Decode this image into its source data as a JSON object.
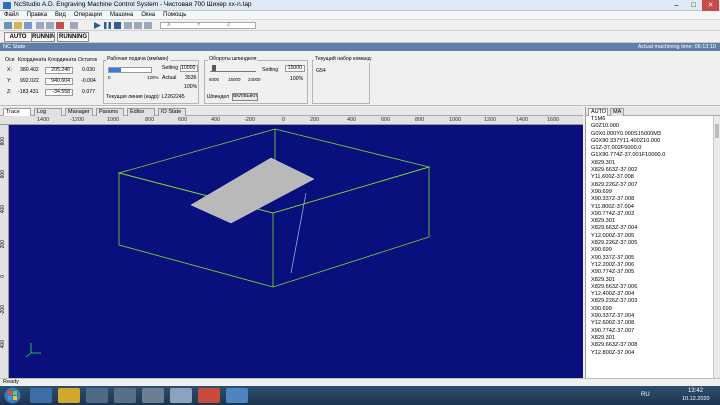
{
  "window": {
    "title": "NcStudio A.D. Engraving Machine Control System - Чистовая 700 Шихер xx-n.tap"
  },
  "menu": [
    "Файл",
    "Правка",
    "Вид",
    "Операции",
    "Машина",
    "Окна",
    "Помощь"
  ],
  "toolbar": {
    "x_label": "X",
    "y_label": "Y",
    "z_label": "Z"
  },
  "modes": [
    "AUTO",
    "RUNNING",
    "RUNNING"
  ],
  "state_header": {
    "title": "NC State",
    "actual_time": "Actual machining time: 06:13:10"
  },
  "coords": {
    "headers": [
      "Оси",
      "Координата",
      "Координата",
      "Остаток"
    ],
    "rows": [
      {
        "axis": "X:",
        "machine": "380.402",
        "work": "205.246",
        "rest": "0.030"
      },
      {
        "axis": "Y:",
        "machine": "992.022",
        "work": "940.604",
        "rest": "-0.004"
      },
      {
        "axis": "Z:",
        "machine": "-183.431",
        "work": "-34.558",
        "rest": "0.077"
      }
    ]
  },
  "feed": {
    "title": "Рабочая подача (мм/мин)",
    "scale_max": "120%",
    "setting_label": "Setting",
    "setting_value": "10000",
    "actual_label": "Actual",
    "actual_value": "3536",
    "percent": "100%",
    "line_label": "Текущая линия (кадр): L2262245",
    "override_fraction": 0.28
  },
  "spindle": {
    "title": "Обороты шпинделя",
    "ticks": [
      "6000",
      "15000",
      "24000"
    ],
    "setting_label": "Setting",
    "setting_value": "15000",
    "percent": "100%",
    "spindle_label": "Шпиндел",
    "spindle_state": "ВКЛ/ВЫКЛ"
  },
  "command": {
    "title": "Текущий набор команд:",
    "value": "G54"
  },
  "tabs": [
    "Trace",
    "Log",
    "Manager",
    "Params",
    "Editor",
    "IO State"
  ],
  "ruler": [
    "1400",
    "-1200",
    "1000",
    "800",
    "600",
    "400",
    "-200",
    "0",
    "200",
    "400",
    "600",
    "800",
    "1000",
    "1200",
    "1400",
    "1600"
  ],
  "vruler": [
    "800",
    "600",
    "400",
    "200",
    "0",
    "-200",
    "400"
  ],
  "right_tabs": [
    "AUTO",
    "MA"
  ],
  "code_lines": [
    "T1M6",
    "G0Z10.000",
    "G0X0.000Y0.000S15000M3",
    "G0X90.337Y11.400Z10.000",
    "G1Z-37.002F5000.0",
    "G1X90.774Z-37.001F10000.0",
    "X829.301",
    "X829.663Z-37.002",
    "Y11.600Z-37.008",
    "X829.226Z-37.007",
    "X90.699",
    "X90.337Z-37.008",
    "Y11.800Z-37.004",
    "X90.774Z-37.003",
    "X829.301",
    "X829.663Z-37.004",
    "Y12.000Z-37.005",
    "X829.226Z-37.005",
    "X90.699",
    "X90.337Z-37.005",
    "Y12.200Z-37.006",
    "X90.774Z-37.005",
    "X829.301",
    "X829.663Z-37.006",
    "Y12.400Z-37.004",
    "X829.226Z-37.003",
    "X90.699",
    "X90.337Z-37.004",
    "Y12.600Z-37.008",
    "X90.774Z-37.007",
    "X829.301",
    "X829.663Z-37.008",
    "Y12.800Z-37.004"
  ],
  "status": {
    "text": "Ready"
  },
  "taskbar": {
    "lang": "RU",
    "time": "13:42",
    "date": "10.12.2020"
  }
}
